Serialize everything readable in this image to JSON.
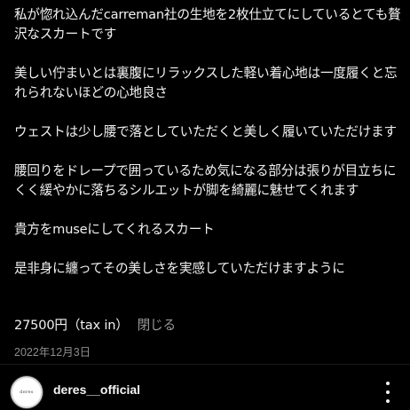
{
  "post": {
    "caption_paragraphs": [
      "私が惚れ込んだcarreman社の生地を2枚仕立てにしているとても贅沢なスカートです",
      "美しい佇まいとは裏腹にリラックスした軽い着心地は一度履くと忘れられないほどの心地良さ",
      "ウェストは少し腰で落としていただくと美しく履いていただけます",
      "腰回りをドレープで囲っているため気になる部分は張りが目立ちにくく緩やかに落ちるシルエットが脚を綺麗に魅せてくれます",
      "貴方をmuseにしてくれるスカート",
      "是非身に纏ってその美しさを実感していただけますように"
    ],
    "price": "27500円（tax in）",
    "close_label": "閉じる",
    "date": "2022年12月3日"
  },
  "account": {
    "username": "deres__official",
    "avatar_text": "deres"
  },
  "colors": {
    "background": "#000000",
    "text": "#f2f2f2",
    "muted": "#8e8e8e"
  }
}
